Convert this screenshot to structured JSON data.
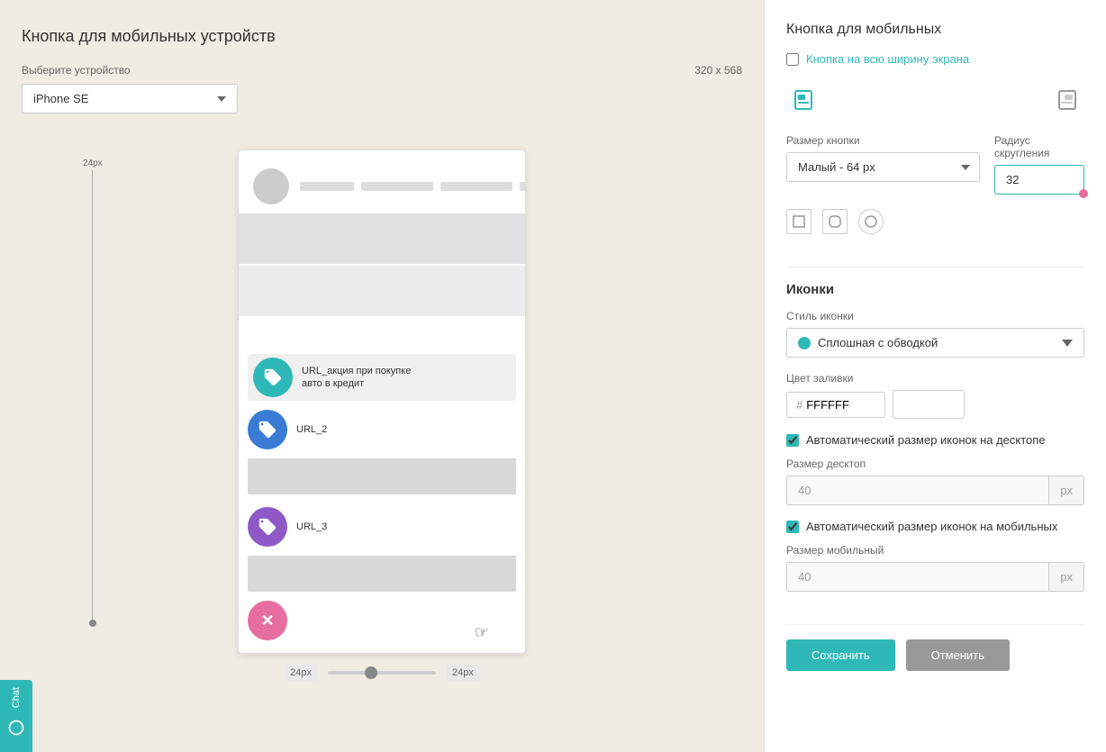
{
  "page": {
    "title": "Кнопка для мобильных устройств",
    "device_label": "Выберите устройство",
    "device_size": "320 x 568",
    "device_options": [
      "iPhone SE"
    ],
    "device_selected": "iPhone SE",
    "zoom_min_label": "24px",
    "zoom_max_label": "24px"
  },
  "right_panel": {
    "section_title": "Кнопка для мобильных",
    "full_width_label": "Кнопка на всю ширину экрана",
    "full_width_checked": false,
    "button_size_label": "Размер кнопки",
    "button_size_value": "Малый - 64 px",
    "border_radius_label": "Радиус скругления",
    "border_radius_value": "32",
    "icons_title": "Иконки",
    "icon_style_label": "Стиль иконки",
    "icon_style_value": "Сплошная с обводкой",
    "fill_color_label": "Цвет заливки",
    "fill_color_value": "FFFFFF",
    "auto_size_desktop_label": "Автоматический размер иконок на десктопе",
    "auto_size_desktop_checked": true,
    "desktop_size_label": "Размер десктоп",
    "desktop_size_value": "40",
    "desktop_size_unit": "px",
    "auto_size_mobile_label": "Автоматический размер иконок на мобильных",
    "auto_size_mobile_checked": true,
    "mobile_size_label": "Размер мобильный",
    "mobile_size_value": "40",
    "mobile_size_unit": "px",
    "save_btn": "Сохранить",
    "cancel_btn": "Отменить"
  },
  "phone_preview": {
    "buttons": [
      {
        "id": 1,
        "color_class": "c1",
        "title": "URL_акция при покупке",
        "subtitle": "авто в кредит",
        "active": true
      },
      {
        "id": 2,
        "color_class": "c2",
        "title": "URL_2",
        "subtitle": ""
      },
      {
        "id": 3,
        "color_class": "c3",
        "title": "URL_3",
        "subtitle": ""
      },
      {
        "id": 4,
        "color_class": "c4",
        "title": "",
        "subtitle": "",
        "close": true
      }
    ]
  },
  "chat_sidebar": {
    "label": "Chat"
  }
}
